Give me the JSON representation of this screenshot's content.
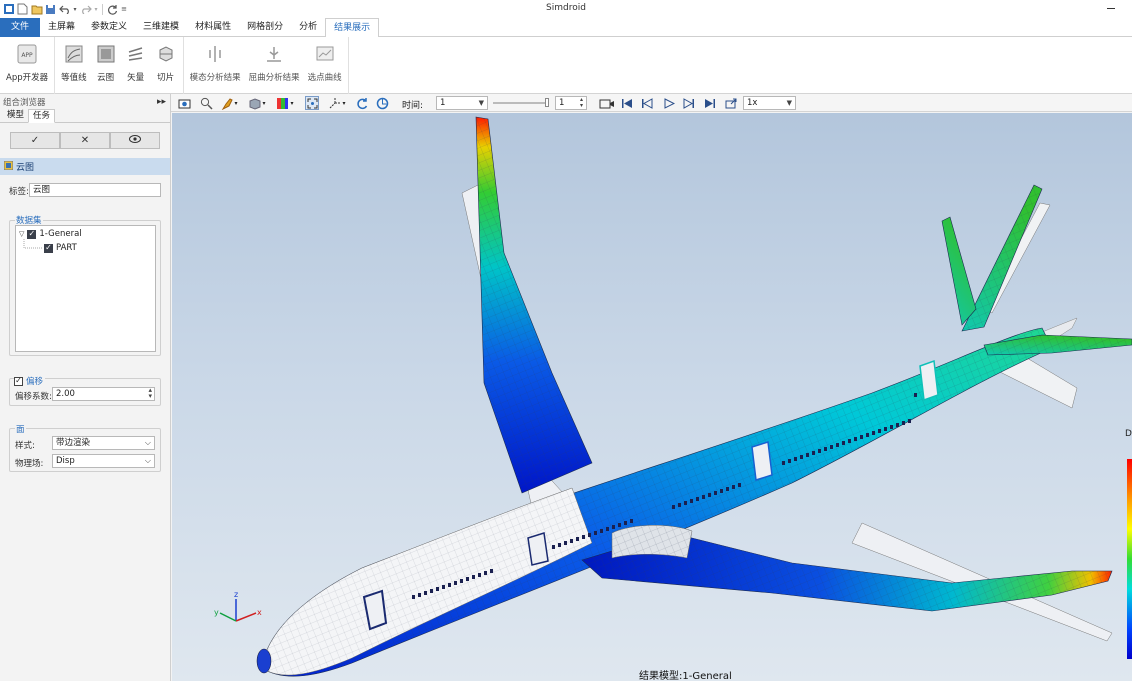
{
  "app": {
    "title": "Simdroid"
  },
  "menu": {
    "tabs": [
      {
        "label": "文件"
      },
      {
        "label": "主屏幕"
      },
      {
        "label": "参数定义"
      },
      {
        "label": "三维建模"
      },
      {
        "label": "材料属性"
      },
      {
        "label": "网格剖分"
      },
      {
        "label": "分析"
      },
      {
        "label": "结果展示"
      }
    ],
    "active_tab": "结果展示"
  },
  "ribbon": {
    "groups": [
      {
        "buttons": [
          {
            "label": "App开发器",
            "icon": "app-icon"
          }
        ]
      },
      {
        "buttons": [
          {
            "label": "等值线",
            "icon": "contour-icon"
          },
          {
            "label": "云图",
            "icon": "cloud-map-icon"
          },
          {
            "label": "矢量",
            "icon": "vector-icon"
          },
          {
            "label": "切片",
            "icon": "slice-icon"
          }
        ]
      },
      {
        "buttons": [
          {
            "label": "模态分析结果",
            "icon": "modal-result-icon"
          },
          {
            "label": "屈曲分析结果",
            "icon": "buckling-result-icon"
          },
          {
            "label": "选点曲线",
            "icon": "point-curve-icon"
          }
        ]
      }
    ]
  },
  "browser": {
    "title": "组合浏览器",
    "tabs": [
      {
        "label": "模型"
      },
      {
        "label": "任务"
      }
    ],
    "active_tab": "任务",
    "actions": {
      "confirm": "✓",
      "cancel": "✕",
      "preview": "👁"
    },
    "section_title": "云图",
    "label_field": {
      "label": "标签:",
      "value": "云图"
    },
    "dataset": {
      "title": "数据集",
      "items": [
        {
          "label": "1-General",
          "checked": true
        },
        {
          "label": "PART",
          "checked": true
        }
      ]
    },
    "offset": {
      "title": "偏移",
      "checked": true,
      "factor_label": "偏移系数:",
      "factor_value": "2.00"
    },
    "surface": {
      "title": "面",
      "style_label": "样式:",
      "style_value": "带边渲染",
      "field_label": "物理场:",
      "field_value": "Disp"
    }
  },
  "view_toolbar": {
    "time_label": "时间:",
    "time_value": "1",
    "frame_value": "1",
    "speed_value": "1x"
  },
  "viewport": {
    "model_label": "结果模型:1-General",
    "legend_title": "D",
    "triad": {
      "x": "x",
      "y": "y",
      "z": "z"
    }
  },
  "colors": {
    "accent": "#2a6ebd",
    "section_bg": "#c9dbee"
  }
}
